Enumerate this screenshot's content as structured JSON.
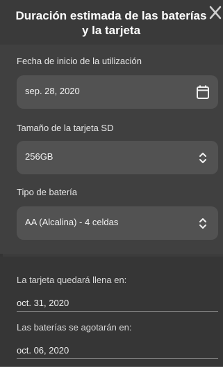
{
  "header": {
    "title": "Duración estimada de las baterías y la tarjeta",
    "close_icon": "close-icon"
  },
  "form": {
    "start_date": {
      "label": "Fecha de inicio de la utilización",
      "value": "sep. 28, 2020",
      "icon": "calendar-icon"
    },
    "sd_size": {
      "label": "Tamaño de la tarjeta SD",
      "value": "256GB",
      "icon": "chevron-updown-icon"
    },
    "battery": {
      "label": "Tipo de batería",
      "value": "AA (Alcalina) - 4 celdas",
      "icon": "chevron-updown-icon"
    }
  },
  "results": {
    "card_full_label": "La tarjeta quedará llena en:",
    "card_full_value": "oct. 31, 2020",
    "battery_empty_label": "Las baterías se agotarán en:",
    "battery_empty_value": "oct. 06, 2020"
  }
}
